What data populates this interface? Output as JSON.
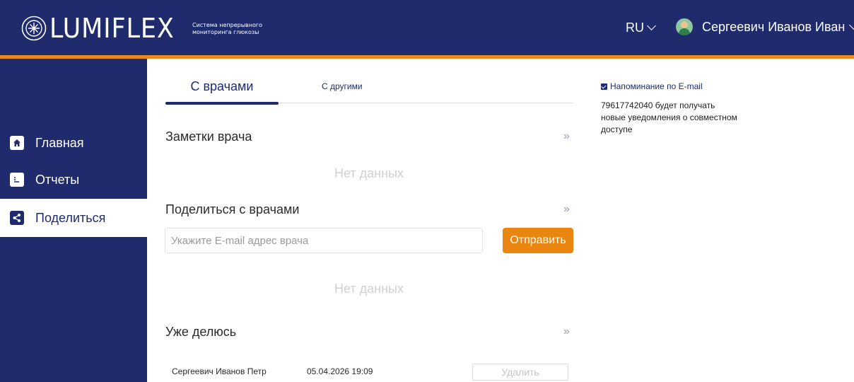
{
  "header": {
    "logo_text": "LUMIFLEX",
    "tagline": "Система непрерывного мониторинга глюкозы",
    "language": "RU",
    "user_name": "Сергеевич Иванов Иван",
    "colors": {
      "primary": "#1f2b6c",
      "accent": "#ea8a1a"
    }
  },
  "sidebar": {
    "items": [
      {
        "label": "Главная",
        "icon": "home-icon",
        "active": false
      },
      {
        "label": "Отчеты",
        "icon": "report-icon",
        "active": false
      },
      {
        "label": "Поделиться",
        "icon": "share-icon",
        "active": true
      }
    ]
  },
  "main": {
    "tabs": [
      {
        "label": "С врачами",
        "active": true
      },
      {
        "label": "С другими",
        "active": false
      }
    ],
    "notes": {
      "title": "Заметки врача",
      "empty": "Нет данных"
    },
    "share_doctors": {
      "title": "Поделиться с врачами",
      "placeholder": "Укажите E-mail адрес врача",
      "value": "",
      "send_label": "Отправить",
      "empty": "Нет данных"
    },
    "sharing": {
      "title": "Уже делюсь",
      "rows": [
        {
          "name": "Сергеевич Иванов Петр",
          "date": "05.04.2026 19:09",
          "delete_label": "Удалить"
        }
      ]
    },
    "more_symbol": "»"
  },
  "right_panel": {
    "reminder_label": "Напоминание по E-mail",
    "reminder_checked": true,
    "reminder_note": "79617742040 будет получать новые уведомления о совместном доступе"
  }
}
